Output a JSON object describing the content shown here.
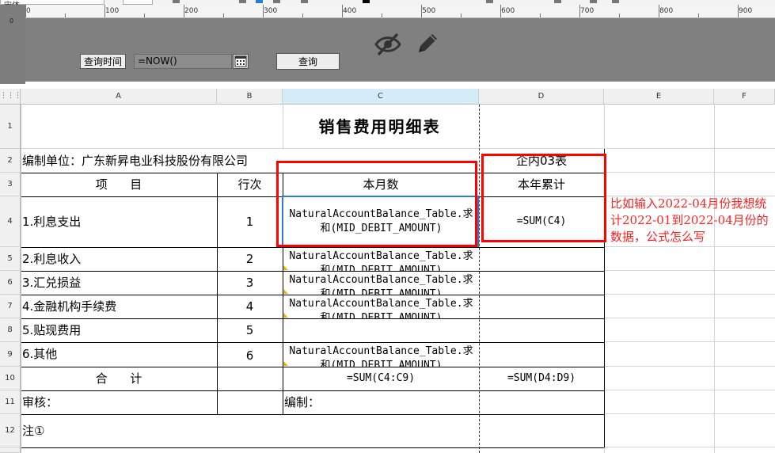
{
  "toolbar": {
    "font_name": "宋体"
  },
  "ruler": {
    "labels": [
      "0",
      "100",
      "200",
      "300",
      "400",
      "500",
      "600",
      "700",
      "800",
      "900"
    ]
  },
  "params": {
    "query_time_label": "查询时间",
    "date_value": "=NOW()",
    "query_button": "查询",
    "icons": [
      "eye-off-icon",
      "pencil-icon",
      "calendar-icon"
    ]
  },
  "sheet": {
    "columns": [
      "A",
      "B",
      "C",
      "D",
      "E",
      "F"
    ],
    "rows": [
      "1",
      "2",
      "3",
      "4",
      "5",
      "6",
      "7",
      "8",
      "9",
      "10",
      "11",
      "12"
    ],
    "title": "销售费用明细表",
    "unit_label": "编制单位：广东新昇电业科技股份有限公司",
    "form_code": "企内03表",
    "header": {
      "item": "项      目",
      "line_no": "行次",
      "month": "本月数",
      "ytd": "本年累计"
    },
    "items": [
      {
        "name": "1.利息支出",
        "line": "1",
        "formula_1": "NaturalAccountBalance_Table.求",
        "formula_2": "和(MID_DEBIT_AMOUNT)",
        "ytd": "=SUM(C4)"
      },
      {
        "name": "2.利息收入",
        "line": "2",
        "formula_1": "NaturalAccountBalance_Table.求",
        "formula_2": "和(MID_DEBIT_AMOUNT)",
        "ytd": ""
      },
      {
        "name": "3.汇兑损益",
        "line": "3",
        "formula_1": "NaturalAccountBalance_Table.求",
        "formula_2": "和(MID_DEBIT_AMOUNT)",
        "ytd": ""
      },
      {
        "name": "4.金融机构手续费",
        "line": "4",
        "formula_1": "NaturalAccountBalance_Table.求",
        "formula_2": "和(MID_DEBIT_AMOUNT)",
        "ytd": ""
      },
      {
        "name": "5.贴现费用",
        "line": "5",
        "formula_1": "",
        "formula_2": "",
        "ytd": ""
      },
      {
        "name": "6.其他",
        "line": "6",
        "formula_1": "NaturalAccountBalance_Table.求",
        "formula_2": "和(MID_DEBIT_AMOUNT)",
        "ytd": ""
      }
    ],
    "total_label": "合      计",
    "total_month": "=SUM(C4:C9)",
    "total_ytd": "=SUM(D4:D9)",
    "reviewer_label": "审核：",
    "preparer_label": "编制：",
    "note_label": "注①"
  },
  "annotation": {
    "text": "比如输入2022-04月份我想统计2022-01到2022-04月份的数据，公式怎么写",
    "color": "#ff2020"
  },
  "colors": {
    "selection": "#2b7cd3",
    "highlight_box": "#ff0000",
    "param_bg": "#808080",
    "selected_col_header": "#d4ecf7"
  }
}
